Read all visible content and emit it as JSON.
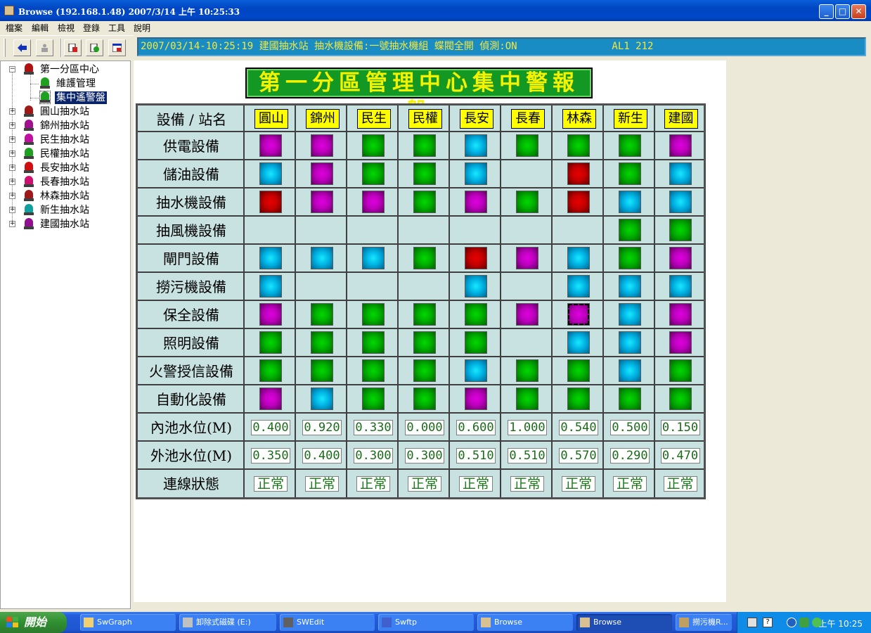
{
  "window": {
    "title": "Browse (192.168.1.48)    2007/3/14 上午 10:25:33",
    "minimize_glyph": "_",
    "maximize_glyph": "□",
    "close_glyph": "✕"
  },
  "menu": [
    "檔案",
    "編輯",
    "檢視",
    "登錄",
    "工具",
    "說明"
  ],
  "toolbar": {
    "buttons": [
      "back-icon",
      "user-icon",
      "document-icon",
      "refresh-icon",
      "exit-icon"
    ]
  },
  "status_line": "2007/03/14-10:25:19 建國抽水站 抽水機設備:一號抽水機組 蝶閥全開 偵測:ON                AL1 212",
  "tree": {
    "root": "第一分區中心",
    "children": [
      "維護管理",
      "集中遙警盤"
    ],
    "stations": [
      "圓山抽水站",
      "錦州抽水站",
      "民生抽水站",
      "民權抽水站",
      "長安抽水站",
      "長春抽水站",
      "林森抽水站",
      "新生抽水站",
      "建國抽水站"
    ],
    "expander_minus": "−",
    "expander_plus": "+",
    "lamp_colors": {
      "root": "#b01010",
      "maint": "#20a020",
      "central": "#20a020",
      "stations": [
        "#a01818",
        "#a01090",
        "#c010a0",
        "#20a020",
        "#d01010",
        "#d01070",
        "#a01818",
        "#10a0a0",
        "#901090"
      ]
    }
  },
  "panel": {
    "title": "第一分區管理中心集中警報盤",
    "corner_label": "設備 / 站名",
    "stations": [
      "圓山",
      "錦州",
      "民生",
      "民權",
      "長安",
      "長春",
      "林森",
      "新生",
      "建國"
    ],
    "rows": [
      {
        "label": "供電設備",
        "cells": [
          "magenta",
          "magenta",
          "green",
          "green",
          "cyan",
          "green",
          "green",
          "green",
          "magenta"
        ]
      },
      {
        "label": "儲油設備",
        "cells": [
          "cyan",
          "magenta",
          "green",
          "green",
          "cyan",
          "",
          "red",
          "green",
          "cyan"
        ]
      },
      {
        "label": "抽水機設備",
        "cells": [
          "red",
          "magenta",
          "magenta",
          "green",
          "magenta",
          "green",
          "red",
          "cyan",
          "cyan"
        ]
      },
      {
        "label": "抽風機設備",
        "cells": [
          "",
          "",
          "",
          "",
          "",
          "",
          "",
          "green",
          "green"
        ]
      },
      {
        "label": "閘門設備",
        "cells": [
          "cyan",
          "cyan",
          "cyan",
          "green",
          "red",
          "magenta",
          "cyan",
          "green",
          "magenta"
        ]
      },
      {
        "label": "撈污機設備",
        "cells": [
          "cyan",
          "",
          "",
          "",
          "cyan",
          "",
          "cyan",
          "cyan",
          "cyan"
        ]
      },
      {
        "label": "保全設備",
        "cells": [
          "magenta",
          "green",
          "green",
          "green",
          "green",
          "magenta",
          "magenta-sel",
          "cyan",
          "magenta"
        ]
      },
      {
        "label": "照明設備",
        "cells": [
          "green",
          "green",
          "green",
          "green",
          "green",
          "",
          "cyan",
          "cyan",
          "magenta"
        ]
      },
      {
        "label": "火警授信設備",
        "cells": [
          "green",
          "green",
          "green",
          "green",
          "cyan",
          "green",
          "green",
          "cyan",
          "green"
        ]
      },
      {
        "label": "自動化設備",
        "cells": [
          "magenta",
          "cyan",
          "green",
          "green",
          "magenta",
          "green",
          "green",
          "green",
          "green"
        ]
      }
    ],
    "inner_level": {
      "label": "內池水位(M)",
      "values": [
        "0.400",
        "0.920",
        "0.330",
        "0.000",
        "0.600",
        "1.000",
        "0.540",
        "0.500",
        "0.150"
      ]
    },
    "outer_level": {
      "label": "外池水位(M)",
      "values": [
        "0.350",
        "0.400",
        "0.300",
        "0.300",
        "0.510",
        "0.510",
        "0.570",
        "0.290",
        "0.470"
      ]
    },
    "connection": {
      "label": "連線狀態",
      "values": [
        "正常",
        "正常",
        "正常",
        "正常",
        "正常",
        "正常",
        "正常",
        "正常",
        "正常"
      ]
    }
  },
  "taskbar": {
    "start": "開始",
    "tasks": [
      {
        "label": "SwGraph",
        "icon": "folder-icon"
      },
      {
        "label": "卸除式磁碟 (E:)",
        "icon": "drive-icon"
      },
      {
        "label": "SWEdit",
        "icon": "edit-app-icon"
      },
      {
        "label": "Swftp",
        "icon": "ftp-app-icon"
      },
      {
        "label": "Browse",
        "icon": "browse-app-icon"
      },
      {
        "label": "Browse",
        "icon": "browse-app-icon",
        "active": true
      },
      {
        "label": "撈污機R...",
        "icon": "app-icon"
      }
    ],
    "clock": "上午 10:25"
  }
}
